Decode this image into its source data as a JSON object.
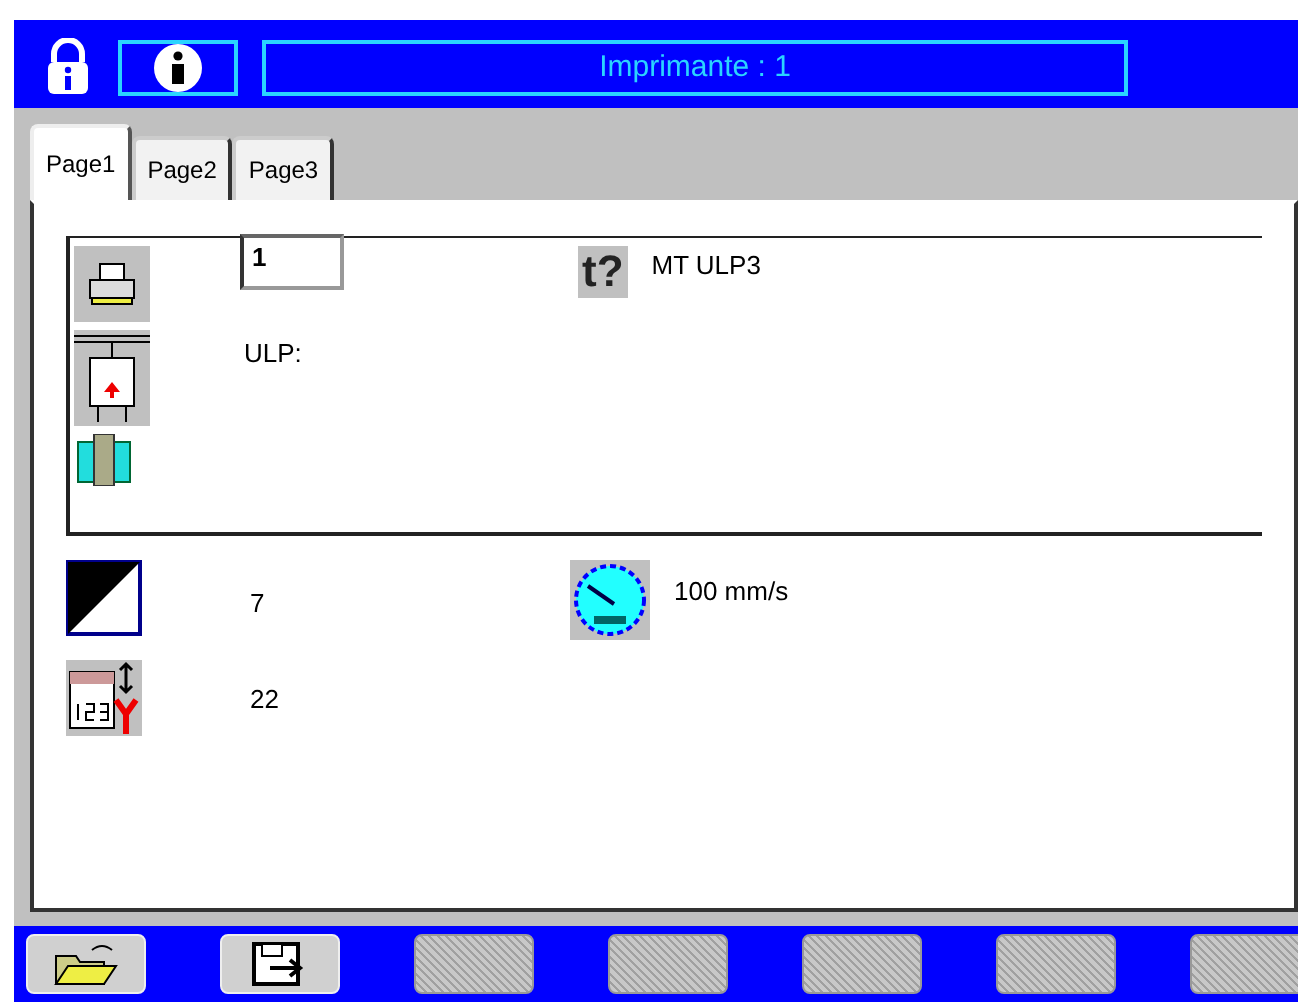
{
  "window": {
    "title": "Imprimante : 1"
  },
  "tabs": [
    {
      "label": "Page1",
      "selected": true
    },
    {
      "label": "Page2",
      "selected": false
    },
    {
      "label": "Page3",
      "selected": false
    }
  ],
  "printer": {
    "number": "1",
    "type_label": "t?",
    "type_value": "MT ULP3",
    "ulp_label": "ULP:"
  },
  "settings": {
    "contrast": "7",
    "speed": "100 mm/s",
    "lines": "22"
  },
  "toolbar": [
    {
      "kind": "open",
      "disabled": false
    },
    {
      "kind": "export",
      "disabled": false
    },
    {
      "kind": "empty",
      "disabled": true
    },
    {
      "kind": "empty",
      "disabled": true
    },
    {
      "kind": "empty",
      "disabled": true
    },
    {
      "kind": "empty",
      "disabled": true
    },
    {
      "kind": "empty",
      "disabled": true
    }
  ]
}
